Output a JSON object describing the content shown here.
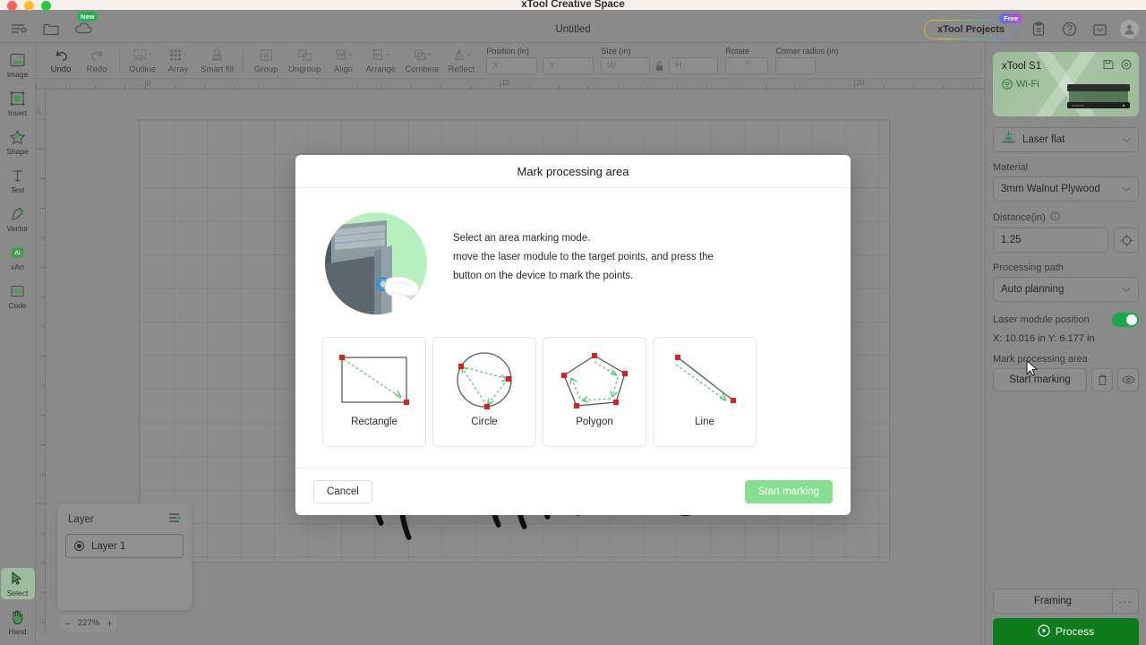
{
  "window": {
    "app_title": "xTool Creative Space",
    "traffic_lights": [
      "close-button",
      "minimize-button",
      "maximize-button"
    ]
  },
  "header": {
    "document_title": "Untitled",
    "left_icons": [
      {
        "name": "menu-icon",
        "label": "Menu"
      },
      {
        "name": "folder-icon",
        "label": "Open"
      },
      {
        "name": "cloud-icon",
        "label": "Cloud",
        "badge": "New"
      }
    ],
    "projects_button": {
      "label": "xTool Projects",
      "badge": "Free"
    },
    "right_icons": [
      {
        "name": "clipboard-icon",
        "label": "Clipboard"
      },
      {
        "name": "help-icon",
        "label": "Help"
      },
      {
        "name": "inbox-icon",
        "label": "Inbox"
      },
      {
        "name": "avatar",
        "label": "Account"
      }
    ]
  },
  "left_rail": {
    "items": [
      {
        "label": "Image",
        "icon": "image-icon"
      },
      {
        "label": "Insert",
        "icon": "insert-icon"
      },
      {
        "label": "Shape",
        "icon": "shape-icon"
      },
      {
        "label": "Text",
        "icon": "text-icon"
      },
      {
        "label": "Vector",
        "icon": "vector-pen-icon"
      },
      {
        "label": "xArt",
        "icon": "xart-icon"
      },
      {
        "label": "Code",
        "icon": "code-icon"
      }
    ],
    "bottom_items": [
      {
        "label": "Select",
        "icon": "select-cursor-icon",
        "active": true
      },
      {
        "label": "Hand",
        "icon": "hand-icon",
        "active": false
      }
    ]
  },
  "toolbar": {
    "buttons": [
      {
        "label": "Undo",
        "icon": "undo-icon"
      },
      {
        "label": "Redo",
        "icon": "redo-icon"
      },
      {
        "label": "Outline",
        "icon": "outline-icon"
      },
      {
        "label": "Array",
        "icon": "array-icon"
      },
      {
        "label": "Smart fill",
        "icon": "smart-fill-icon"
      },
      {
        "label": "Group",
        "icon": "group-icon"
      },
      {
        "label": "Ungroup",
        "icon": "ungroup-icon"
      },
      {
        "label": "Align",
        "icon": "align-icon"
      },
      {
        "label": "Arrange",
        "icon": "arrange-icon"
      },
      {
        "label": "Combine",
        "icon": "combine-icon"
      },
      {
        "label": "Reflect",
        "icon": "reflect-icon"
      }
    ],
    "fields": {
      "position_label": "Position (in)",
      "position_x_placeholder": "X",
      "position_x_value": "",
      "position_y_placeholder": "Y",
      "position_y_value": "",
      "size_label": "Size (in)",
      "size_w_placeholder": "W",
      "size_w_value": "",
      "size_h_placeholder": "H",
      "size_h_value": "",
      "lock_icon": "lock-open-icon",
      "rotate_label": "Rotate",
      "rotate_placeholder": "°",
      "rotate_value": "",
      "corner_radius_label": "Corner radius (in)",
      "corner_radius_value": ""
    }
  },
  "canvas": {
    "ruler_h_labels": [
      "0",
      "10",
      "20"
    ],
    "ruler_v_labels": [
      "0"
    ],
    "zoom": {
      "value": "227%",
      "minus": "−",
      "plus": "+"
    }
  },
  "layer_panel": {
    "title": "Layer",
    "menu_icon": "layer-options-icon",
    "layers": [
      {
        "name": "Layer 1",
        "selected": true
      }
    ]
  },
  "right_panel": {
    "device": {
      "name": "xTool S1",
      "connection": "Wi-Fi",
      "connection_icon": "wifi-icon",
      "card_icons": [
        "save-icon",
        "settings-icon"
      ]
    },
    "mode_select": {
      "value": "Laser flat",
      "icon": "laser-flat-icon"
    },
    "material_label": "Material",
    "material_value": "3mm Walnut Plywood",
    "distance_label": "Distance(in)",
    "distance_info_icon": "info-icon",
    "distance_value": "1.25",
    "distance_measure_icon": "measure-target-icon",
    "processing_path_label": "Processing path",
    "processing_path_value": "Auto planning",
    "laser_module_position_label": "Laser module position",
    "laser_module_toggle_on": true,
    "coordinates": "X: 10.016 in   Y: 6.177 in",
    "mark_processing_area_label": "Mark processing area",
    "start_marking_label": "Start marking",
    "delete_icon": "trash-icon",
    "preview_icon": "eye-icon",
    "framing_label": "Framing",
    "framing_more_icon": "more-dots-icon",
    "process_label": "Process",
    "process_icon": "play-icon"
  },
  "modal": {
    "title": "Mark processing area",
    "illustration": "device-button-press-illustration",
    "description_lines": [
      "Select an area marking mode.",
      "move the laser module to the target points, and press the",
      "button on the device to mark the points."
    ],
    "modes": [
      {
        "label": "Rectangle",
        "icon": "rectangle-mode-icon"
      },
      {
        "label": "Circle",
        "icon": "circle-mode-icon"
      },
      {
        "label": "Polygon",
        "icon": "polygon-mode-icon"
      },
      {
        "label": "Line",
        "icon": "line-mode-icon"
      }
    ],
    "cancel_label": "Cancel",
    "confirm_label": "Start marking"
  },
  "colors": {
    "accent_green": "#19a84b",
    "process_green": "#0d7a1b",
    "start_marking_green": "#86de92",
    "marker_red": "#e02020",
    "arrow_green": "#5ecb7a"
  }
}
